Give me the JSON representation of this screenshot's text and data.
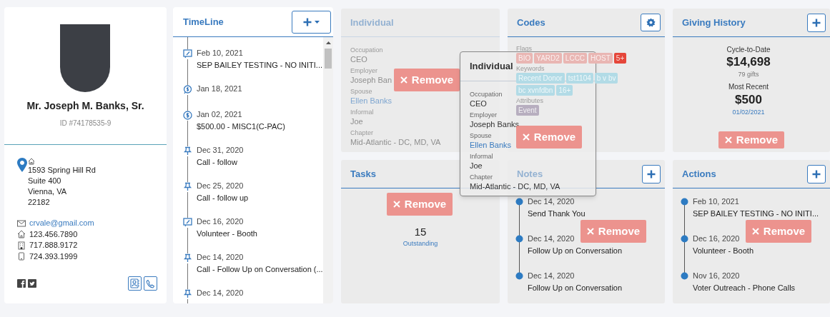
{
  "profile": {
    "name": "Mr. Joseph M. Banks, Sr.",
    "id_label": "ID #74178535-9",
    "address": [
      "1593 Spring Hill Rd",
      "Suite 400",
      "Vienna, VA",
      "22182"
    ],
    "contacts": [
      {
        "kind": "email",
        "text": "crvale@gmail.com"
      },
      {
        "kind": "home",
        "text": "123.456.7890"
      },
      {
        "kind": "office",
        "text": "717.888.9172"
      },
      {
        "kind": "mobile",
        "text": "724.393.1999"
      }
    ]
  },
  "timeline": {
    "title": "TimeLine",
    "items": [
      {
        "kind": "note",
        "date": "Feb 10, 2021",
        "text": "SEP BAILEY TESTING - NO INITI..."
      },
      {
        "kind": "gift",
        "date": "Jan 18, 2021"
      },
      {
        "kind": "donation",
        "date": "Jan 02, 2021",
        "text": "$500.00 - MISC1(C-PAC)"
      },
      {
        "kind": "pin",
        "date": "Dec 31, 2020",
        "text": "Call - follow"
      },
      {
        "kind": "pin",
        "date": "Dec 25, 2020",
        "text": "Call - follow up"
      },
      {
        "kind": "note",
        "date": "Dec 16, 2020",
        "text": "Volunteer - Booth"
      },
      {
        "kind": "pin",
        "date": "Dec 14, 2020",
        "text": "Call - Follow Up on Conversation (..."
      },
      {
        "kind": "pin",
        "date": "Dec 14, 2020"
      }
    ]
  },
  "individual_placeholder": {
    "title": "Individual",
    "fields": [
      {
        "label": "Occupation",
        "value": "CEO"
      },
      {
        "label": "Employer",
        "value": "Joseph Ban"
      },
      {
        "label": "Spouse",
        "value": "Ellen Banks",
        "link": true
      },
      {
        "label": "Informal",
        "value": "Joe"
      },
      {
        "label": "Chapter",
        "value": "Mid-Atlantic - DC, MD, VA"
      }
    ],
    "remove": "Remove"
  },
  "codes": {
    "title": "Codes",
    "flags_label": "Flags",
    "flags": [
      "BIO",
      "YARD2",
      "LCCC",
      "HOST",
      "5+"
    ],
    "keywords_label": "Keywords",
    "keywords": [
      "Recent Donor",
      "tst1104",
      "b v bv",
      "bc xvnfdbn",
      "16+"
    ],
    "attributes_label": "Attributes",
    "attributes": [
      "Event"
    ],
    "remove": "Remove"
  },
  "giving_history": {
    "title": "Giving History",
    "cycle_label": "Cycle-to-Date",
    "cycle_amount": "$14,698",
    "gifts": "79 gifts",
    "recent_label": "Most Recent",
    "recent_amount": "$500",
    "recent_date": "01/02/2021",
    "remove": "Remove"
  },
  "tasks": {
    "title": "Tasks",
    "count": "15",
    "count_label": "Outstanding",
    "remove": "Remove"
  },
  "notes": {
    "title": "Notes",
    "items": [
      {
        "date": "Dec 14, 2020",
        "text": "Send Thank You"
      },
      {
        "date": "Dec 14, 2020",
        "text": "Follow Up on Conversation"
      },
      {
        "date": "Dec 14, 2020",
        "text": "Follow Up on Conversation"
      }
    ],
    "remove": "Remove"
  },
  "actions": {
    "title": "Actions",
    "items": [
      {
        "date": "Feb 10, 2021",
        "text": "SEP BAILEY TESTING - NO INITI..."
      },
      {
        "date": "Dec 16, 2020",
        "text": "Volunteer - Booth"
      },
      {
        "date": "Nov 16, 2020",
        "text": "Voter Outreach - Phone Calls"
      }
    ],
    "remove": "Remove"
  },
  "dragged_card": {
    "title": "Individual",
    "fields": [
      {
        "label": "Occupation",
        "value": "CEO"
      },
      {
        "label": "Employer",
        "value": "Joseph Banks"
      },
      {
        "label": "Spouse",
        "value": "Ellen Banks",
        "link": true
      },
      {
        "label": "Informal",
        "value": "Joe"
      },
      {
        "label": "Chapter",
        "value": "Mid-Atlantic - DC, MD, VA"
      }
    ]
  }
}
